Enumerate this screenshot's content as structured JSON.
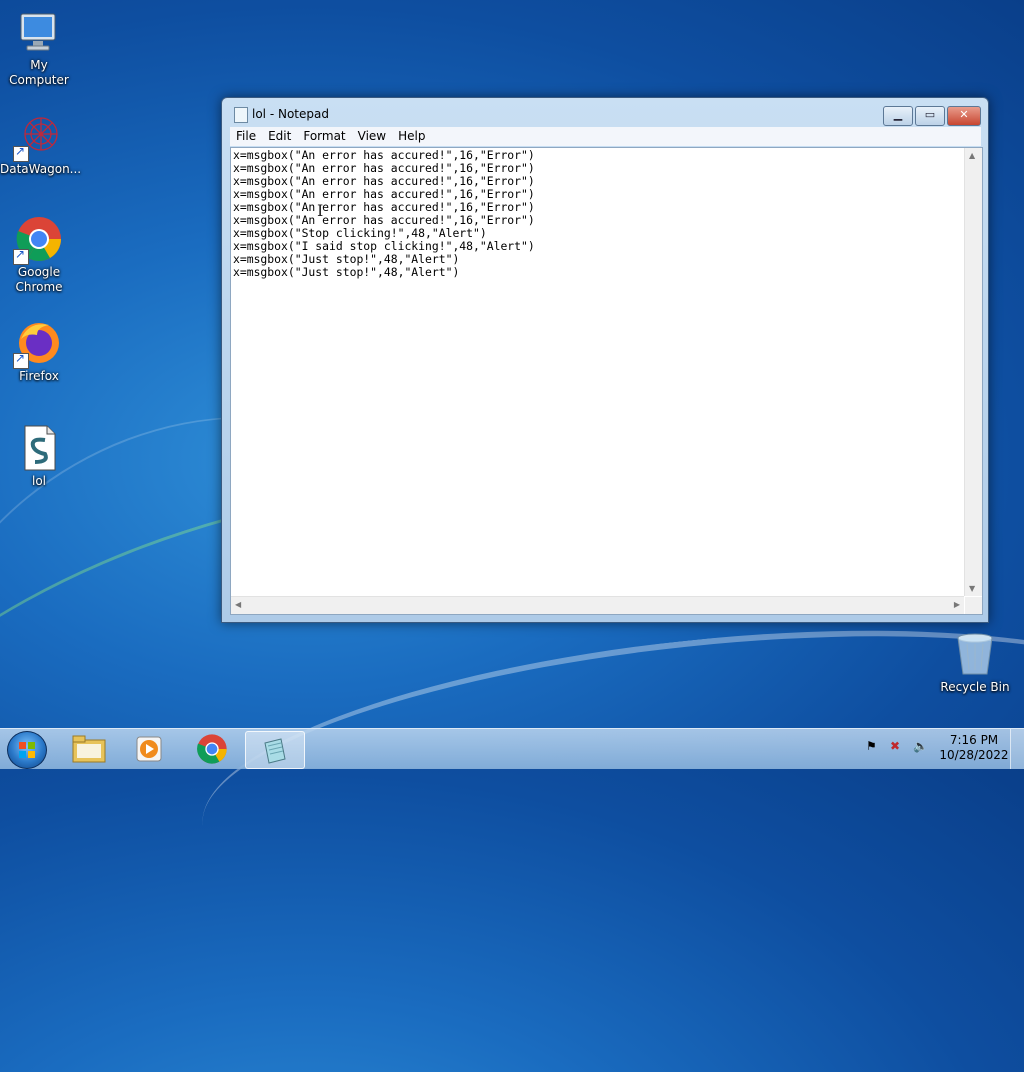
{
  "desktop": {
    "icons": [
      {
        "label": "My Computer"
      },
      {
        "label": "DataWagon..."
      },
      {
        "label": "Google\nChrome"
      },
      {
        "label": "Firefox"
      },
      {
        "label": "lol"
      },
      {
        "label": "Recycle Bin"
      }
    ]
  },
  "notepad": {
    "title": "lol - Notepad",
    "menu": [
      "File",
      "Edit",
      "Format",
      "View",
      "Help"
    ],
    "content": "x=msgbox(\"An error has accured!\",16,\"Error\")\nx=msgbox(\"An error has accured!\",16,\"Error\")\nx=msgbox(\"An error has accured!\",16,\"Error\")\nx=msgbox(\"An error has accured!\",16,\"Error\")\nx=msgbox(\"An error has accured!\",16,\"Error\")\nx=msgbox(\"An error has accured!\",16,\"Error\")\nx=msgbox(\"Stop clicking!\",48,\"Alert\")\nx=msgbox(\"I said stop clicking!\",48,\"Alert\")\nx=msgbox(\"Just stop!\",48,\"Alert\")\nx=msgbox(\"Just stop!\",48,\"Alert\")"
  },
  "taskbar": {
    "pinned": [
      "windows-explorer",
      "media-player",
      "google-chrome",
      "notepad"
    ],
    "active": "notepad",
    "time": "7:16 PM",
    "date": "10/28/2022"
  },
  "colors": {
    "desktop_bg": "#1a6cc0",
    "close_button": "#c74631",
    "taskbar": "#a9c8e6"
  }
}
